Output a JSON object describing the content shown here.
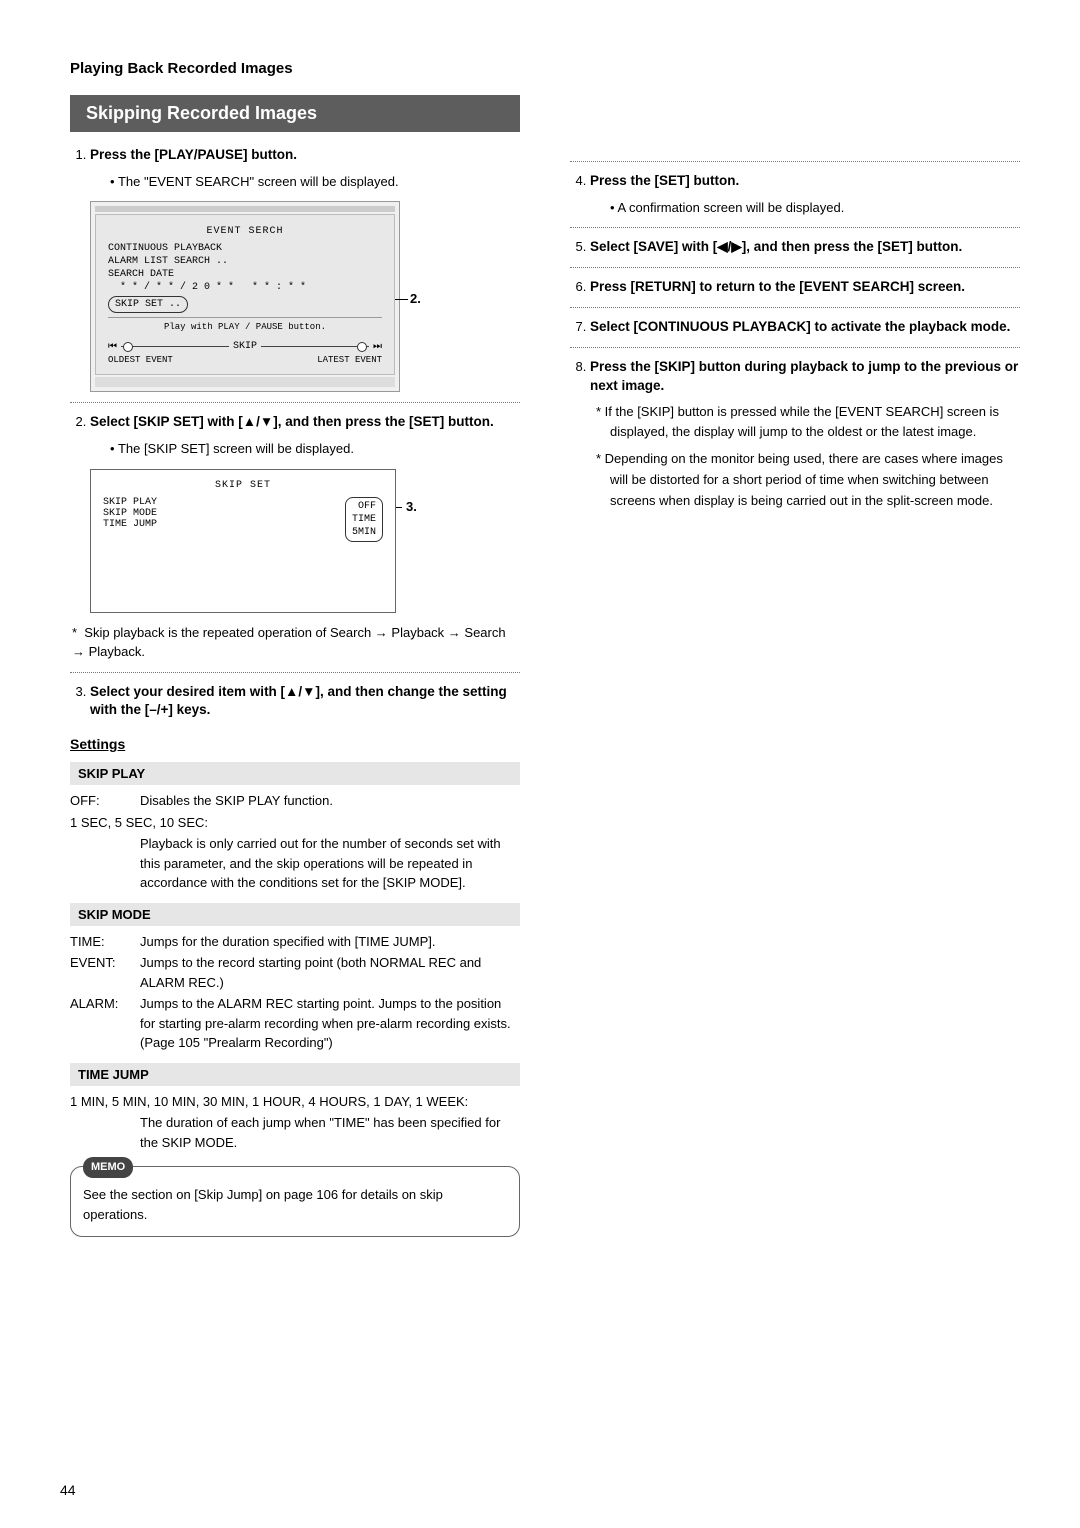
{
  "page_title": "Playing Back Recorded Images",
  "section_title": "Skipping Recorded Images",
  "page_number": "44",
  "callouts": {
    "c2": "2.",
    "c3": "3."
  },
  "left": {
    "step1": {
      "text": "Press the [PLAY/PAUSE] button.",
      "bullet": "The \"EVENT SEARCH\" screen will be displayed."
    },
    "event_screen": {
      "title": "EVENT SERCH",
      "line1": "CONTINUOUS PLAYBACK",
      "line2": "ALARM LIST SEARCH ..",
      "line3": "SEARCH DATE",
      "line4": "  * * / * * / 2 0 * *   * * : * *",
      "skip_set": "SKIP SET ..",
      "play_note": "Play with PLAY / PAUSE button.",
      "skip_label": "SKIP",
      "oldest": "OLDEST EVENT",
      "latest": "LATEST EVENT",
      "rew_icon": "⏮",
      "ff_icon": "⏭"
    },
    "step2": {
      "text": "Select [SKIP SET] with [▲/▼], and then press the [SET] button.",
      "bullet": "The [SKIP SET] screen will be displayed."
    },
    "skipset_screen": {
      "title": "SKIP SET",
      "r1": "SKIP PLAY",
      "r2": "SKIP MODE",
      "r3": "TIME JUMP",
      "v1": "OFF",
      "v2": "TIME",
      "v3": "5MIN"
    },
    "skip_note": "Skip playback is the repeated operation of Search → Playback → Search → Playback.",
    "step3": {
      "text": "Select your desired item with [▲/▼], and then change the setting with the [–/+] keys."
    },
    "settings_label": "Settings",
    "skip_play": {
      "title": "SKIP PLAY",
      "off_label": "OFF:",
      "off_text": "Disables the SKIP PLAY function.",
      "sec_label": "1 SEC, 5 SEC, 10 SEC:",
      "sec_text": "Playback is only carried out for the number of seconds set with this parameter, and the skip operations will be repeated in accordance with the conditions set for the [SKIP MODE]."
    },
    "skip_mode": {
      "title": "SKIP MODE",
      "time_label": "TIME:",
      "time_text": "Jumps for the duration specified with [TIME JUMP].",
      "event_label": "EVENT:",
      "event_text": "Jumps to the record starting point (both NORMAL REC and ALARM REC.)",
      "alarm_label": "ALARM:",
      "alarm_text": "Jumps to the ALARM REC starting point. Jumps to the position for starting pre-alarm recording when pre-alarm recording exists. (Page 105 \"Prealarm Recording\")"
    },
    "time_jump": {
      "title": "TIME JUMP",
      "opts": "1 MIN, 5 MIN, 10 MIN, 30 MIN, 1 HOUR, 4 HOURS, 1 DAY, 1 WEEK:",
      "text": "The duration of each jump when \"TIME\" has been specified for the SKIP MODE."
    },
    "memo_label": "MEMO",
    "memo_text": "See the section on [Skip Jump] on page 106 for details on skip operations."
  },
  "right": {
    "step4": {
      "text": "Press the [SET] button.",
      "bullet": "A confirmation screen will be displayed."
    },
    "step5": {
      "text": "Select [SAVE] with [◀/▶], and then press the [SET] button."
    },
    "step6": {
      "text": "Press [RETURN] to return to the [EVENT SEARCH] screen."
    },
    "step7": {
      "text": "Select [CONTINUOUS PLAYBACK] to activate the playback mode."
    },
    "step8": {
      "text": "Press the [SKIP] button during playback to jump to the previous or next image.",
      "note1": "If the [SKIP] button is pressed while the [EVENT SEARCH] screen is displayed, the display will jump to the oldest or the latest image.",
      "note2": "Depending on the monitor being used, there are cases where images will be distorted for a short period of time when switching between screens when display is being carried out in the split-screen mode."
    }
  }
}
